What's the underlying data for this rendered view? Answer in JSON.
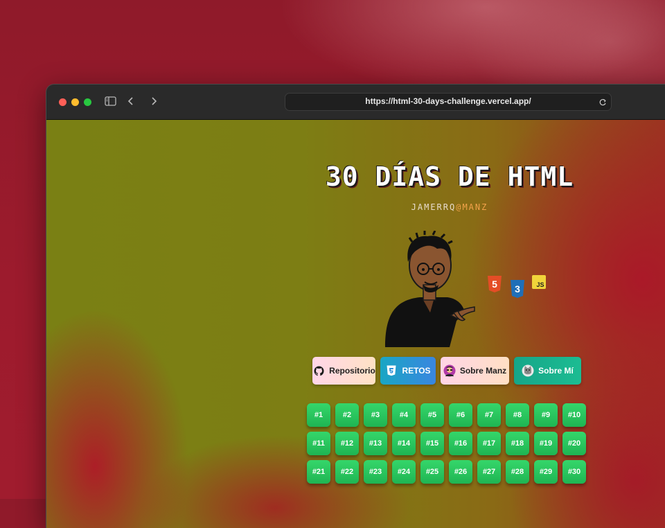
{
  "browser": {
    "url": "https://html-30-days-challenge.vercel.app/",
    "icons": [
      "sidebar-icon",
      "back-icon",
      "forward-icon",
      "reload-icon"
    ]
  },
  "page": {
    "title": "30 DÍAS DE HTML",
    "subtitle_prefix": "JAMERRQ",
    "subtitle_at": "@",
    "subtitle_accent": "MANZ",
    "tech_badges": [
      "5",
      "3",
      "JS"
    ],
    "buttons": [
      {
        "label": "Repositorio",
        "icon": "github-icon"
      },
      {
        "label": "RETOS",
        "icon": "html5-icon"
      },
      {
        "label": "Sobre Manz",
        "icon": "manz-avatar-icon"
      },
      {
        "label": "Sobre Mí",
        "icon": "cat-avatar-icon"
      }
    ],
    "days": [
      "#1",
      "#2",
      "#3",
      "#4",
      "#5",
      "#6",
      "#7",
      "#8",
      "#9",
      "#10",
      "#11",
      "#12",
      "#13",
      "#14",
      "#15",
      "#16",
      "#17",
      "#18",
      "#19",
      "#20",
      "#21",
      "#22",
      "#23",
      "#24",
      "#25",
      "#26",
      "#27",
      "#28",
      "#29",
      "#30"
    ]
  },
  "colors": {
    "html5": "#e44d26",
    "css3": "#1f6fb8",
    "js": "#f0d43a",
    "day_button": "#2bc95f",
    "accent": "#f2a24a"
  }
}
